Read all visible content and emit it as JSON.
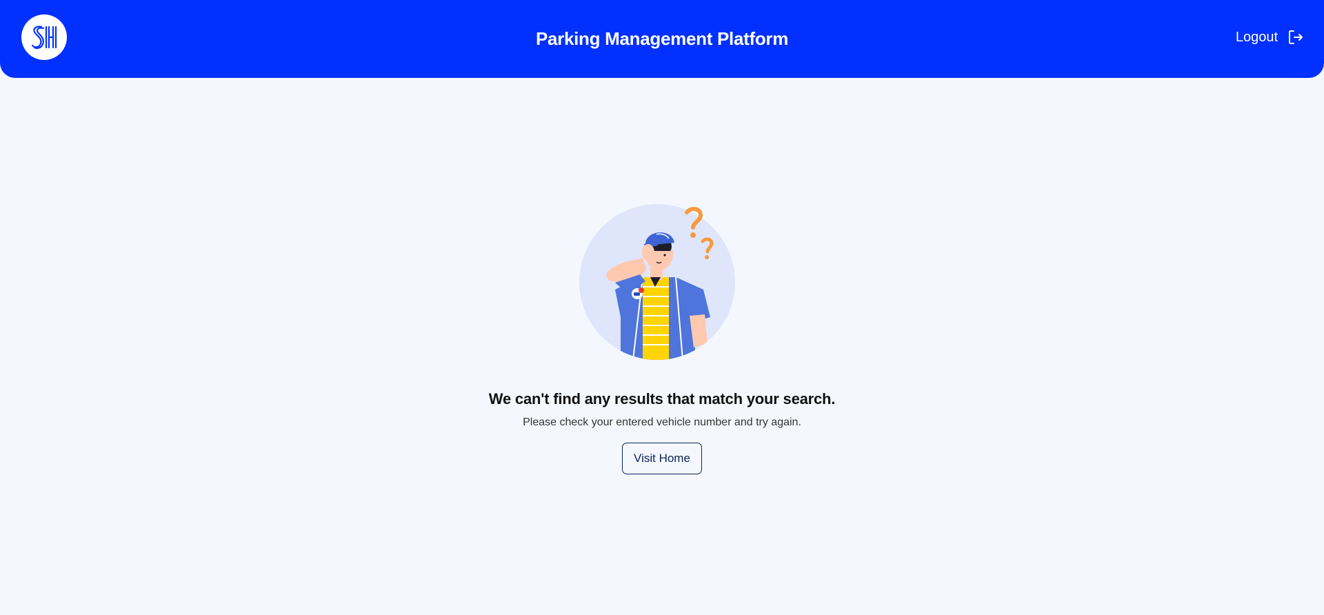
{
  "header": {
    "logo_text": "SM",
    "title": "Parking Management Platform",
    "logout_label": "Logout",
    "logout_icon": "logout-icon",
    "background_color": "#0130ff"
  },
  "empty_state": {
    "illustration": "confused-attendant-illustration",
    "headline": "We can't find any results that match your search.",
    "message": "Please check your entered vehicle number and try again.",
    "button_label": "Visit Home"
  },
  "colors": {
    "page_background": "#f4f8fe",
    "accent": "#0130ff",
    "question_mark": "#f79a3e",
    "shirt": "#ffd400"
  }
}
